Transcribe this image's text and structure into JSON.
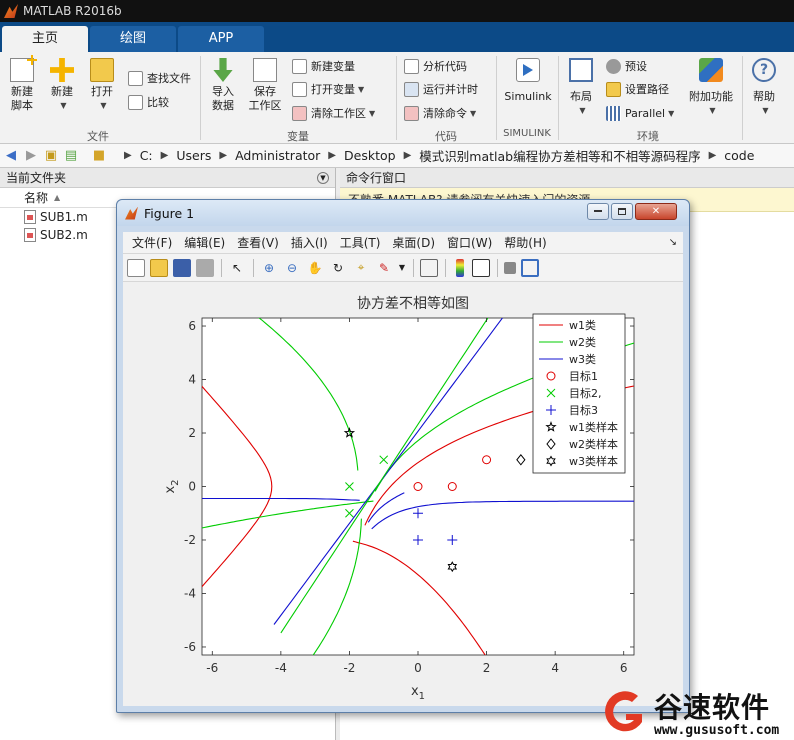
{
  "app": {
    "title": "MATLAB R2016b"
  },
  "tabs": [
    {
      "label": "主页"
    },
    {
      "label": "绘图"
    },
    {
      "label": "APP"
    }
  ],
  "ribbon": {
    "file": {
      "new_script": "新建\n脚本",
      "new": "新建",
      "open": "打开",
      "find_files": "查找文件",
      "compare": "比较",
      "group": "文件"
    },
    "variable": {
      "import": "导入\n数据",
      "save_ws": "保存\n工作区",
      "new_var": "新建变量",
      "open_var": "打开变量",
      "clear_ws": "清除工作区",
      "group": "变量"
    },
    "code": {
      "analyze": "分析代码",
      "run_time": "运行并计时",
      "clear_cmd": "清除命令",
      "group": "代码"
    },
    "simulink": {
      "simulink": "Simulink",
      "group": "SIMULINK"
    },
    "env": {
      "layout": "布局",
      "prefs": "预设",
      "set_path": "设置路径",
      "parallel": "Parallel",
      "addons": "附加功能",
      "group": "环境"
    },
    "help": {
      "help": "帮助"
    }
  },
  "path": {
    "crumbs": [
      "C:",
      "Users",
      "Administrator",
      "Desktop",
      "模式识别matlab编程协方差相等和不相等源码程序",
      "code"
    ]
  },
  "left_panel": {
    "title": "当前文件夹",
    "column": "名称",
    "files": [
      {
        "name": "SUB1.m"
      },
      {
        "name": "SUB2.m"
      }
    ]
  },
  "cmd_panel": {
    "title": "命令行窗口",
    "notice": "不熟悉 MATLAB? 请参阅有关快速入门的资源。"
  },
  "figure": {
    "title": "Figure 1",
    "menu": [
      "文件(F)",
      "编辑(E)",
      "查看(V)",
      "插入(I)",
      "工具(T)",
      "桌面(D)",
      "窗口(W)",
      "帮助(H)"
    ],
    "arrow": "↘",
    "close": "✕"
  },
  "chart_data": {
    "type": "line",
    "title": "协方差不相等如图",
    "xlabel": "x",
    "xlabel_sub": "1",
    "ylabel": "x",
    "ylabel_sub": "2",
    "xlim": [
      -6.3,
      6.3
    ],
    "ylim": [
      -6.3,
      6.3
    ],
    "xticks": [
      -6,
      -4,
      -2,
      0,
      2,
      4,
      6
    ],
    "yticks": [
      -6,
      -4,
      -2,
      0,
      2,
      4,
      6
    ],
    "grid": false,
    "legend_position": "top-right",
    "colors": {
      "w1": "#e00000",
      "w2": "#00cc00",
      "w3": "#1010d0",
      "sample": "#000000"
    },
    "series": [
      {
        "name": "w1类",
        "kind": "line",
        "color": "#e00000"
      },
      {
        "name": "w2类",
        "kind": "line",
        "color": "#00cc00"
      },
      {
        "name": "w3类",
        "kind": "line",
        "color": "#1010d0"
      },
      {
        "name": "目标1",
        "kind": "marker",
        "marker": "circle",
        "color": "#e00000",
        "points": [
          [
            0,
            0
          ],
          [
            1,
            0
          ],
          [
            2,
            1
          ]
        ]
      },
      {
        "name": "目标2,",
        "kind": "marker",
        "marker": "x",
        "color": "#00cc00",
        "points": [
          [
            -2,
            0
          ],
          [
            -2,
            -1
          ],
          [
            -1,
            1
          ]
        ]
      },
      {
        "name": "目标3",
        "kind": "marker",
        "marker": "plus",
        "color": "#1010d0",
        "points": [
          [
            0,
            -1
          ],
          [
            0,
            -2
          ],
          [
            1,
            -2
          ]
        ]
      },
      {
        "name": "w1类样本",
        "kind": "marker",
        "marker": "pentagram",
        "color": "#000000",
        "points": [
          [
            -2,
            2
          ]
        ]
      },
      {
        "name": "w2类样本",
        "kind": "marker",
        "marker": "diamond",
        "color": "#000000",
        "points": [
          [
            3,
            1
          ]
        ]
      },
      {
        "name": "w3类样本",
        "kind": "marker",
        "marker": "hexagram",
        "color": "#000000",
        "points": [
          [
            1,
            -3
          ]
        ]
      }
    ]
  },
  "watermark": {
    "brand": "谷速软件",
    "url": "www.gususoft.com"
  }
}
